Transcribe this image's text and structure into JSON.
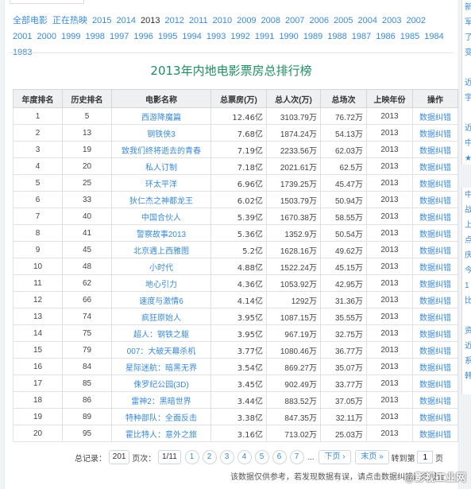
{
  "year_nav": [
    {
      "label": "全部电影",
      "current": false
    },
    {
      "label": "正在热映",
      "current": false
    },
    {
      "label": "2015",
      "current": false
    },
    {
      "label": "2014",
      "current": false
    },
    {
      "label": "2013",
      "current": true
    },
    {
      "label": "2012",
      "current": false
    },
    {
      "label": "2011",
      "current": false
    },
    {
      "label": "2010",
      "current": false
    },
    {
      "label": "2009",
      "current": false
    },
    {
      "label": "2008",
      "current": false
    },
    {
      "label": "2007",
      "current": false
    },
    {
      "label": "2006",
      "current": false
    },
    {
      "label": "2005",
      "current": false
    },
    {
      "label": "2004",
      "current": false
    },
    {
      "label": "2003",
      "current": false
    },
    {
      "label": "2002",
      "current": false
    },
    {
      "label": "2001",
      "current": false
    },
    {
      "label": "2000",
      "current": false
    },
    {
      "label": "1999",
      "current": false
    },
    {
      "label": "1998",
      "current": false
    },
    {
      "label": "1997",
      "current": false
    },
    {
      "label": "1996",
      "current": false
    },
    {
      "label": "1995",
      "current": false
    },
    {
      "label": "1994",
      "current": false
    },
    {
      "label": "1993",
      "current": false
    },
    {
      "label": "1992",
      "current": false
    },
    {
      "label": "1991",
      "current": false
    },
    {
      "label": "1990",
      "current": false
    },
    {
      "label": "1989",
      "current": false
    },
    {
      "label": "1988",
      "current": false
    },
    {
      "label": "1987",
      "current": false
    },
    {
      "label": "1986",
      "current": false
    },
    {
      "label": "1985",
      "current": false
    },
    {
      "label": "1984",
      "current": false
    },
    {
      "label": "1983",
      "current": false
    }
  ],
  "page_title": "2013年内地电影票房总排行榜",
  "table": {
    "headers": [
      "年度排名",
      "历史排名",
      "电影名称",
      "总票房(万)",
      "总人次(万)",
      "总场次",
      "上映年份",
      "操作"
    ],
    "rows": [
      {
        "rank": "1",
        "hist": "5",
        "name": "西游降魔篇",
        "gross": "12.46亿",
        "admissions": "3103.79万",
        "shows": "76.72万",
        "year": "2013",
        "op": "数据纠错"
      },
      {
        "rank": "2",
        "hist": "13",
        "name": "钢铁侠3",
        "gross": "7.68亿",
        "admissions": "1874.24万",
        "shows": "54.13万",
        "year": "2013",
        "op": "数据纠错"
      },
      {
        "rank": "3",
        "hist": "19",
        "name": "致我们终将逝去的青春",
        "gross": "7.19亿",
        "admissions": "2233.56万",
        "shows": "62.03万",
        "year": "2013",
        "op": "数据纠错"
      },
      {
        "rank": "4",
        "hist": "20",
        "name": "私人订制",
        "gross": "7.18亿",
        "admissions": "2021.61万",
        "shows": "62.5万",
        "year": "2013",
        "op": "数据纠错"
      },
      {
        "rank": "5",
        "hist": "25",
        "name": "环太平洋",
        "gross": "6.96亿",
        "admissions": "1739.25万",
        "shows": "45.47万",
        "year": "2013",
        "op": "数据纠错"
      },
      {
        "rank": "6",
        "hist": "33",
        "name": "狄仁杰之神都龙王",
        "gross": "6.02亿",
        "admissions": "1503.79万",
        "shows": "50.94万",
        "year": "2013",
        "op": "数据纠错"
      },
      {
        "rank": "7",
        "hist": "40",
        "name": "中国合伙人",
        "gross": "5.39亿",
        "admissions": "1670.38万",
        "shows": "58.55万",
        "year": "2013",
        "op": "数据纠错"
      },
      {
        "rank": "8",
        "hist": "41",
        "name": "警察故事2013",
        "gross": "5.36亿",
        "admissions": "1352.9万",
        "shows": "50.54万",
        "year": "2013",
        "op": "数据纠错"
      },
      {
        "rank": "9",
        "hist": "45",
        "name": "北京遇上西雅图",
        "gross": "5.2亿",
        "admissions": "1628.16万",
        "shows": "49.62万",
        "year": "2013",
        "op": "数据纠错"
      },
      {
        "rank": "10",
        "hist": "48",
        "name": "小时代",
        "gross": "4.88亿",
        "admissions": "1522.24万",
        "shows": "45.15万",
        "year": "2013",
        "op": "数据纠错"
      },
      {
        "rank": "11",
        "hist": "62",
        "name": "地心引力",
        "gross": "4.36亿",
        "admissions": "1053.92万",
        "shows": "42.95万",
        "year": "2013",
        "op": "数据纠错"
      },
      {
        "rank": "12",
        "hist": "66",
        "name": "速度与激情6",
        "gross": "4.14亿",
        "admissions": "1292万",
        "shows": "31.36万",
        "year": "2013",
        "op": "数据纠错"
      },
      {
        "rank": "13",
        "hist": "74",
        "name": "疯狂原始人",
        "gross": "3.95亿",
        "admissions": "1087.15万",
        "shows": "35.55万",
        "year": "2013",
        "op": "数据纠错"
      },
      {
        "rank": "14",
        "hist": "75",
        "name": "超人：钢铁之躯",
        "gross": "3.95亿",
        "admissions": "967.19万",
        "shows": "32.75万",
        "year": "2013",
        "op": "数据纠错"
      },
      {
        "rank": "15",
        "hist": "79",
        "name": "007：大破天幕杀机",
        "gross": "3.77亿",
        "admissions": "1080.46万",
        "shows": "36.77万",
        "year": "2013",
        "op": "数据纠错"
      },
      {
        "rank": "16",
        "hist": "84",
        "name": "星际迷航：暗黑无界",
        "gross": "3.54亿",
        "admissions": "869.27万",
        "shows": "35.07万",
        "year": "2013",
        "op": "数据纠错"
      },
      {
        "rank": "17",
        "hist": "85",
        "name": "侏罗纪公园(3D)",
        "gross": "3.45亿",
        "admissions": "902.49万",
        "shows": "33.77万",
        "year": "2013",
        "op": "数据纠错"
      },
      {
        "rank": "18",
        "hist": "86",
        "name": "雷神2：黑暗世界",
        "gross": "3.44亿",
        "admissions": "883.52万",
        "shows": "37.05万",
        "year": "2013",
        "op": "数据纠错"
      },
      {
        "rank": "19",
        "hist": "89",
        "name": "特种部队：全面反击",
        "gross": "3.38亿",
        "admissions": "847.35万",
        "shows": "32.11万",
        "year": "2013",
        "op": "数据纠错"
      },
      {
        "rank": "20",
        "hist": "95",
        "name": "霍比特人：意外之旅",
        "gross": "3.16亿",
        "admissions": "713.02万",
        "shows": "25.03万",
        "year": "2013",
        "op": "数据纠错"
      }
    ]
  },
  "pager": {
    "total_label": "总记录：",
    "total": "201",
    "page_label": "页次：",
    "page_info": "1/11",
    "pages": [
      "1",
      "2",
      "3",
      "4",
      "5",
      "6",
      "7"
    ],
    "ellipsis": "...",
    "next": "下页 ›",
    "last": "末页 »",
    "goto_label": "转到第",
    "goto_value": "1",
    "page_unit": "页"
  },
  "note": "该数据仅供参考，若发现数据有误，请点击数据纠错进行报告",
  "watermark": "@影视工业网",
  "right_fragments_1": [
    "新",
    "军",
    "了",
    "变",
    "",
    "近",
    "宇",
    "",
    "近",
    "中",
    "★",
    "猴"
  ],
  "right_fragments_2": [
    "中",
    "战",
    "上",
    "点",
    "庆",
    "今",
    "1",
    "比",
    "",
    "资",
    "近",
    "系",
    "韩"
  ]
}
